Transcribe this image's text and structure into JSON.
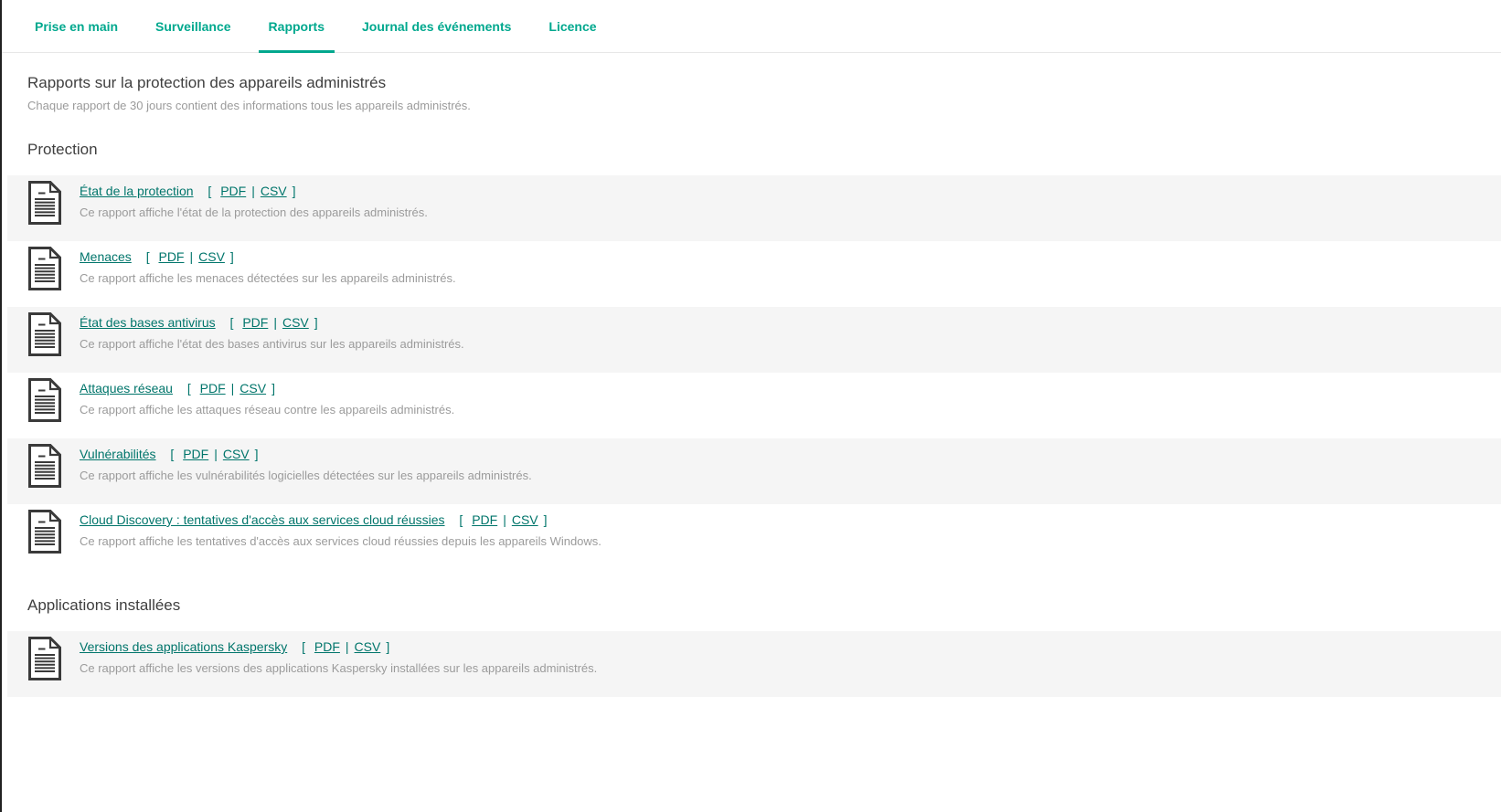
{
  "tabs": [
    {
      "label": "Prise en main",
      "active": false
    },
    {
      "label": "Surveillance",
      "active": false
    },
    {
      "label": "Rapports",
      "active": true
    },
    {
      "label": "Journal des événements",
      "active": false
    },
    {
      "label": "Licence",
      "active": false
    }
  ],
  "header": {
    "title": "Rapports sur la protection des appareils administrés",
    "subtitle": "Chaque rapport de 30 jours contient des informations tous les appareils administrés."
  },
  "link_symbols": {
    "open": "[",
    "separator": "|",
    "close": "]"
  },
  "sections": [
    {
      "heading": "Protection",
      "reports": [
        {
          "title": "État de la protection",
          "formats": [
            "PDF",
            "CSV"
          ],
          "description": "Ce rapport affiche l'état de la protection des appareils administrés."
        },
        {
          "title": "Menaces",
          "formats": [
            "PDF",
            "CSV"
          ],
          "description": "Ce rapport affiche les menaces détectées sur les appareils administrés."
        },
        {
          "title": "État des bases antivirus",
          "formats": [
            "PDF",
            "CSV"
          ],
          "description": "Ce rapport affiche l'état des bases antivirus sur les appareils administrés."
        },
        {
          "title": "Attaques réseau",
          "formats": [
            "PDF",
            "CSV"
          ],
          "description": "Ce rapport affiche les attaques réseau contre les appareils administrés."
        },
        {
          "title": "Vulnérabilités",
          "formats": [
            "PDF",
            "CSV"
          ],
          "description": "Ce rapport affiche les vulnérabilités logicielles détectées sur les appareils administrés."
        },
        {
          "title": "Cloud Discovery : tentatives d'accès aux services cloud réussies",
          "formats": [
            "PDF",
            "CSV"
          ],
          "description": "Ce rapport affiche les tentatives d'accès aux services cloud réussies depuis les appareils Windows."
        }
      ]
    },
    {
      "heading": "Applications installées",
      "reports": [
        {
          "title": "Versions des applications Kaspersky",
          "formats": [
            "PDF",
            "CSV"
          ],
          "description": "Ce rapport affiche les versions des applications Kaspersky installées sur les appareils administrés."
        }
      ]
    }
  ],
  "icons": {
    "report_icon": "document-icon"
  },
  "colors": {
    "accent": "#00a88e",
    "link": "#00756b",
    "heading_text": "#3f3f3f",
    "muted_text": "#9b9b9b",
    "row_alt_background": "#f5f5f5",
    "divider": "#e7e7e7",
    "icon_stroke": "#3a3a3a"
  }
}
